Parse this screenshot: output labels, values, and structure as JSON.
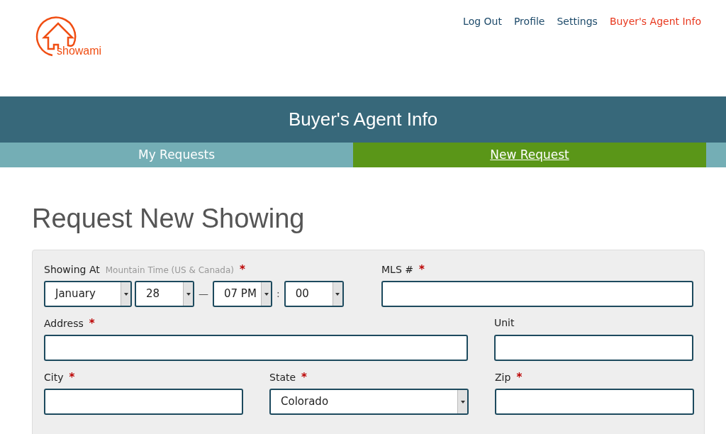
{
  "logo": {
    "text": "showami"
  },
  "nav": [
    {
      "label": "Log Out",
      "selected": false
    },
    {
      "label": "Profile",
      "selected": false
    },
    {
      "label": "Settings",
      "selected": false
    },
    {
      "label": "Buyer's Agent Info",
      "selected": true
    }
  ],
  "banner": {
    "title": "Buyer's Agent Info"
  },
  "tabs": [
    {
      "label": "My Requests",
      "selected": false
    },
    {
      "label": "New Request",
      "selected": true
    }
  ],
  "heading": "Request New Showing",
  "showing_at": {
    "label": "Showing At",
    "hint": "Mountain Time (US & Canada)",
    "required_mark": "*",
    "parts": [
      {
        "kind": "select",
        "value": "January"
      },
      {
        "kind": "select",
        "value": "28"
      },
      {
        "kind": "separator",
        "value": "—"
      },
      {
        "kind": "select",
        "value": "07 PM"
      },
      {
        "kind": "separator",
        "value": ":"
      },
      {
        "kind": "select",
        "value": "00"
      }
    ]
  },
  "rows": [
    [
      {
        "label": "MLS #",
        "required_mark": "*",
        "kind": "text"
      }
    ],
    [
      {
        "label": "Address",
        "required_mark": "*",
        "kind": "text"
      },
      {
        "label": "Unit",
        "kind": "text"
      }
    ],
    [
      {
        "label": "City",
        "required_mark": "*",
        "kind": "text"
      },
      {
        "label": "State",
        "required_mark": "*",
        "kind": "select",
        "value": "Colorado"
      },
      {
        "label": "Zip",
        "required_mark": "*",
        "kind": "text"
      }
    ]
  ]
}
